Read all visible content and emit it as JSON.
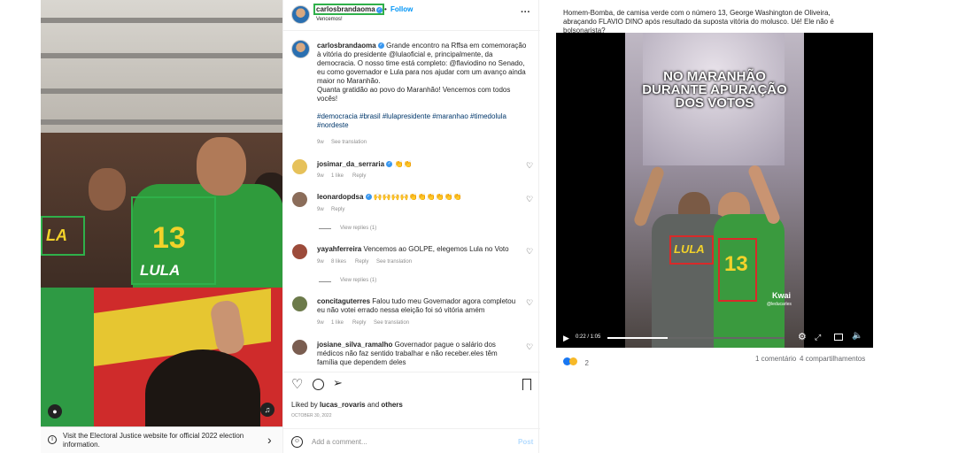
{
  "post": {
    "username": "carlosbrandaoma",
    "follow_label": "Follow",
    "subtitle": "Vencemos!",
    "more_label": "···",
    "caption_user": "carlosbrandaoma",
    "caption_text": "Grande encontro na Rffsa em comemoração à vitória do presidente @lulaoficial e, principalmente, da democracia. O nosso time está completo: @flaviodino no Senado, eu como governador e Lula para nos ajudar com um avanço ainda maior no Maranhão.",
    "caption_text2": "Quanta gratidão ao povo do Maranhão! Vencemos com todos vocês!",
    "hashtags": "#democracia #brasil #lulapresidente #maranhao #timedolula #nordeste",
    "caption_age": "9w",
    "see_translation": "See translation",
    "liked_by_prefix": "Liked by ",
    "liked_by_user": "lucas_rovaris",
    "liked_by_and": " and ",
    "liked_by_others": "others",
    "date": "OCTOBER 30, 2022",
    "comment_placeholder": "Add a comment...",
    "post_label": "Post"
  },
  "comments": [
    {
      "user": "josimar_da_serraria",
      "text": "👏👏",
      "age": "9w",
      "likes": "1 like",
      "reply": "Reply",
      "verified": true
    },
    {
      "user": "leonardopdsa",
      "text": "🙌🙌🙌🙌👏👏👏👏👏👏",
      "age": "9w",
      "reply": "Reply",
      "view_replies": "View replies (1)",
      "verified": true
    },
    {
      "user": "yayahferreira",
      "text": "Vencemos ao GOLPE, elegemos Lula no Voto",
      "age": "9w",
      "likes": "8 likes",
      "reply": "Reply",
      "see_translation": "See translation",
      "view_replies": "View replies (1)"
    },
    {
      "user": "concitaguterres",
      "text": "Falou tudo meu Governador agora completou eu não votei errado nessa eleição foi só vitória amém",
      "age": "9w",
      "likes": "1 like",
      "reply": "Reply",
      "see_translation": "See translation"
    },
    {
      "user": "josiane_silva_ramalho",
      "text": "Governador pague o salário dos médicos não faz sentido trabalhar e não receber.eles têm família que dependem deles"
    }
  ],
  "notice": {
    "text": "Visit the Electoral Justice website for official 2022 election information.",
    "info_icon": "info-icon",
    "arrow": "›"
  },
  "photo": {
    "shirt_number": "13",
    "shirt_word": "LULA",
    "side_logo": "LA"
  },
  "fb_post": {
    "caption": "Homem-Bomba, de camisa verde com o número 13, George Washington de Oliveira, abraçando FLAVIO DINO após resultado da suposta vitória do molusco. Ué! Ele não é  bolsonarista?",
    "overlay_text_1": "NO MARANHÃO",
    "overlay_text_2": "DURANTE APURAÇÃO",
    "overlay_text_3": "DOS VOTOS",
    "video_time": "0:22 / 1:05",
    "progress_fraction": 0.34,
    "watermark": "Kwai",
    "watermark_handle": "@leducarles",
    "shirt_word": "LULA",
    "shirt_number": "13",
    "reactions_count": "2",
    "comments_label": "1 comentário",
    "shares_label": "4 compartilhamentos"
  },
  "colors": {
    "highlight_green": "#2fb04a",
    "highlight_red": "#d92a2a",
    "link_blue": "#0095f6"
  }
}
